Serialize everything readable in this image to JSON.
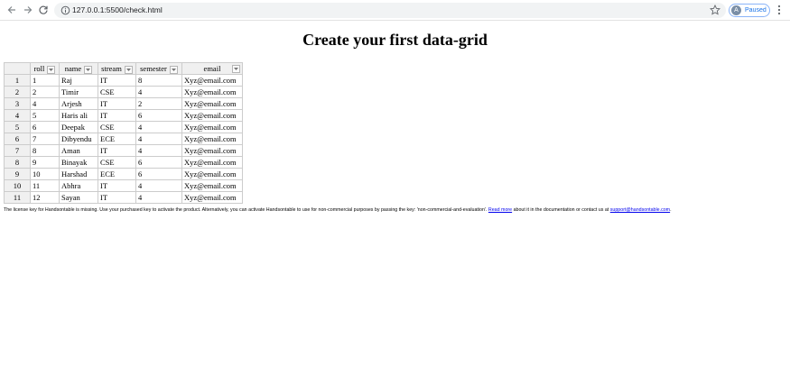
{
  "browser": {
    "url": "127.0.0.1:5500/check.html",
    "profile_initial": "A",
    "profile_status": "Paused"
  },
  "page": {
    "title": "Create your first data-grid"
  },
  "grid": {
    "columns": [
      "roll",
      "name",
      "stream",
      "semester",
      "email"
    ],
    "rows": [
      {
        "index": "1",
        "cells": [
          "1",
          "Raj",
          "IT",
          "8",
          "Xyz@email.com"
        ]
      },
      {
        "index": "2",
        "cells": [
          "2",
          "Timir",
          "CSE",
          "4",
          "Xyz@email.com"
        ]
      },
      {
        "index": "3",
        "cells": [
          "4",
          "Arjesh",
          "IT",
          "2",
          "Xyz@email.com"
        ]
      },
      {
        "index": "4",
        "cells": [
          "5",
          "Haris ali",
          "IT",
          "6",
          "Xyz@email.com"
        ]
      },
      {
        "index": "5",
        "cells": [
          "6",
          "Deepak",
          "CSE",
          "4",
          "Xyz@email.com"
        ]
      },
      {
        "index": "6",
        "cells": [
          "7",
          "Dibyendu",
          "ECE",
          "4",
          "Xyz@email.com"
        ]
      },
      {
        "index": "7",
        "cells": [
          "8",
          "Aman",
          "IT",
          "4",
          "Xyz@email.com"
        ]
      },
      {
        "index": "8",
        "cells": [
          "9",
          "Binayak",
          "CSE",
          "6",
          "Xyz@email.com"
        ]
      },
      {
        "index": "9",
        "cells": [
          "10",
          "Harshad",
          "ECE",
          "6",
          "Xyz@email.com"
        ]
      },
      {
        "index": "10",
        "cells": [
          "11",
          "Abhra",
          "IT",
          "4",
          "Xyz@email.com"
        ]
      },
      {
        "index": "11",
        "cells": [
          "12",
          "Sayan",
          "IT",
          "4",
          "Xyz@email.com"
        ]
      }
    ]
  },
  "license": {
    "text_before": "The license key for Handsontable is missing. Use your purchased key to activate the product. Alternatively, you can activate Handsontable to use for non-commercial purposes by passing the key: 'non-commercial-and-evaluation'. ",
    "read_more_label": "Read more",
    "text_middle": " about it in the documentation or contact us at ",
    "support_email": "support@handsontable.com",
    "text_after": "."
  },
  "icons": {
    "back": "arrow-left-icon",
    "forward": "arrow-right-icon",
    "reload": "reload-icon",
    "site_info": "site-info-icon",
    "bookmark": "star-icon",
    "menu": "kebab-menu-icon",
    "dropdown": "dropdown-arrow-icon"
  }
}
